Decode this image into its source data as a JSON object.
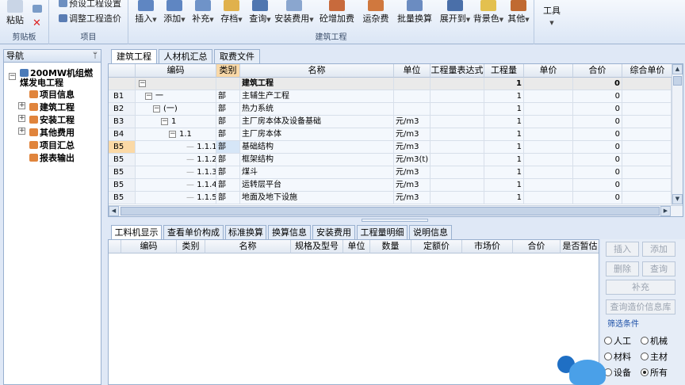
{
  "ribbon": {
    "clipboard": {
      "paste": "粘贴",
      "label": "剪贴板"
    },
    "project": {
      "item1": "预设工程设置",
      "item2": "调整工程造价",
      "label": "项目"
    },
    "buttons": [
      "插入",
      "添加",
      "补充",
      "存档",
      "查询",
      "安装费用",
      "砼增加费",
      "运杂费",
      "批量换算",
      "展开到",
      "背景色",
      "其他"
    ],
    "group_label": "建筑工程",
    "tools": "工具"
  },
  "nav": {
    "title": "导航",
    "pin": "ᛘ",
    "root": "200MW机组燃煤发电工程",
    "items": [
      "项目信息",
      "建筑工程",
      "安装工程",
      "其他费用",
      "项目汇总",
      "报表输出"
    ]
  },
  "top_tabs": [
    "建筑工程",
    "人材机汇总",
    "取费文件"
  ],
  "grid": {
    "headers": [
      "",
      "编码",
      "类别",
      "名称",
      "单位",
      "工程量表达式",
      "工程量",
      "单价",
      "合价",
      "综合单价"
    ],
    "rows": [
      {
        "id": "",
        "code": "",
        "type": "",
        "name": "建筑工程",
        "unit": "",
        "expr": "",
        "qty": "1",
        "price": "",
        "total": "0"
      },
      {
        "id": "B1",
        "code": "一",
        "type": "部",
        "name": "主辅生产工程",
        "unit": "",
        "expr": "",
        "qty": "1",
        "price": "",
        "total": "0"
      },
      {
        "id": "B2",
        "code": "(一)",
        "type": "部",
        "name": "热力系统",
        "unit": "",
        "expr": "",
        "qty": "1",
        "price": "",
        "total": "0"
      },
      {
        "id": "B3",
        "code": "1",
        "type": "部",
        "name": "主厂房本体及设备基础",
        "unit": "元/m3",
        "expr": "",
        "qty": "1",
        "price": "",
        "total": "0"
      },
      {
        "id": "B4",
        "code": "1.1",
        "type": "部",
        "name": "主厂房本体",
        "unit": "元/m3",
        "expr": "",
        "qty": "1",
        "price": "",
        "total": "0"
      },
      {
        "id": "B5",
        "code": "1.1.1",
        "type": "部",
        "name": "基础结构",
        "unit": "元/m3",
        "expr": "",
        "qty": "1",
        "price": "",
        "total": "0"
      },
      {
        "id": "B5",
        "code": "1.1.2",
        "type": "部",
        "name": "框架结构",
        "unit": "元/m3(t)",
        "expr": "",
        "qty": "1",
        "price": "",
        "total": "0"
      },
      {
        "id": "B5",
        "code": "1.1.3",
        "type": "部",
        "name": "煤斗",
        "unit": "元/m3",
        "expr": "",
        "qty": "1",
        "price": "",
        "total": "0"
      },
      {
        "id": "B5",
        "code": "1.1.4",
        "type": "部",
        "name": "运转层平台",
        "unit": "元/m3",
        "expr": "",
        "qty": "1",
        "price": "",
        "total": "0"
      },
      {
        "id": "B5",
        "code": "1.1.5",
        "type": "部",
        "name": "地面及地下设施",
        "unit": "元/m3",
        "expr": "",
        "qty": "1",
        "price": "",
        "total": "0"
      }
    ]
  },
  "bottom_tabs": [
    "工料机显示",
    "查看单价构成",
    "标准换算",
    "换算信息",
    "安装费用",
    "工程量明细",
    "说明信息"
  ],
  "bottom_headers": [
    "编码",
    "类别",
    "名称",
    "规格及型号",
    "单位",
    "数量",
    "定额价",
    "市场价",
    "合价",
    "是否暂估"
  ],
  "side_buttons": {
    "insert": "插入",
    "add": "添加",
    "delete": "删除",
    "query": "查询",
    "supplement": "补充",
    "price_lib": "查询造价信息库"
  },
  "filter": {
    "title": "筛选条件",
    "options": [
      {
        "label": "人工",
        "checked": false
      },
      {
        "label": "机械",
        "checked": false
      },
      {
        "label": "材料",
        "checked": false
      },
      {
        "label": "主材",
        "checked": false
      },
      {
        "label": "设备",
        "checked": false
      },
      {
        "label": "所有",
        "checked": true
      }
    ]
  }
}
